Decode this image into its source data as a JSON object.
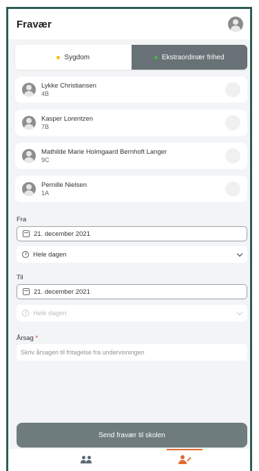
{
  "header": {
    "title": "Fravær"
  },
  "tabs": {
    "sygdom": {
      "label": "Sygdom",
      "dot_color": "#f1c40f"
    },
    "ekstra": {
      "label": "Ekstraordinær frihed",
      "dot_color": "#4caf50",
      "active": true
    }
  },
  "students": [
    {
      "name": "Lykke Christiansen",
      "class": "4B"
    },
    {
      "name": "Kasper Lorentzen",
      "class": "7B"
    },
    {
      "name": "Mathilde Marie Holmgaard Bernhoft Langer",
      "class": "9C"
    },
    {
      "name": "Pernille Nielsen",
      "class": "1A"
    }
  ],
  "form": {
    "fra_label": "Fra",
    "fra_date": "21. december 2021",
    "fra_time": "Hele dagen",
    "til_label": "Til",
    "til_date": "21. december 2021",
    "til_time": "Hele dagen",
    "reason_label": "Årsag",
    "reason_required": "*",
    "reason_placeholder": "Skriv årsagen til fritagelse fra undervisningen"
  },
  "send_button": "Send fravær til skolen",
  "colors": {
    "accent": "#e06a36",
    "button": "#6f7c7d",
    "active_segment": "#687175",
    "frame": "#2f5a56"
  },
  "bottom_nav": [
    {
      "icon": "people-icon"
    },
    {
      "icon": "person-edit-icon",
      "active": true
    }
  ]
}
